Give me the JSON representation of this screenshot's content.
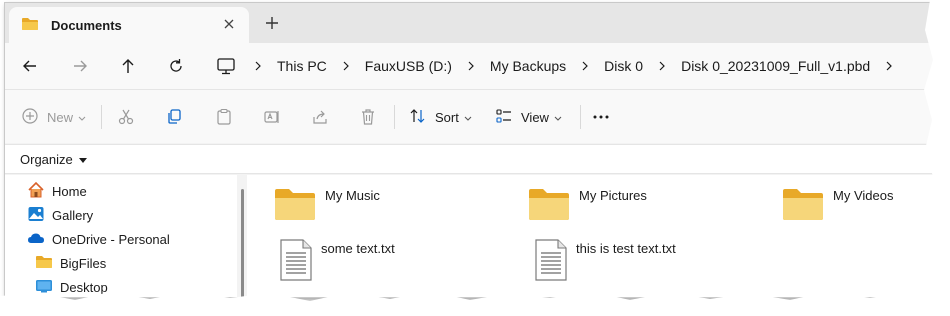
{
  "window": {
    "tab_title": "Documents",
    "new_tab_icon": "plus-icon",
    "close_icon": "close-icon"
  },
  "nav": {
    "back_icon": "arrow-left-icon",
    "forward_icon": "arrow-right-icon",
    "up_icon": "arrow-up-icon",
    "refresh_icon": "refresh-icon"
  },
  "breadcrumb": {
    "root_icon": "computer-icon",
    "items": [
      "This PC",
      "FauxUSB (D:)",
      "My Backups",
      "Disk 0",
      "Disk 0_20231009_Full_v1.pbd"
    ]
  },
  "commands": {
    "new_label": "New",
    "cut_icon": "cut-icon",
    "copy_icon": "copy-icon",
    "paste_icon": "paste-icon",
    "rename_icon": "rename-icon",
    "share_icon": "share-icon",
    "delete_icon": "delete-icon",
    "sort_label": "Sort",
    "view_label": "View",
    "more_icon": "more-icon"
  },
  "organize_label": "Organize",
  "sidebar": {
    "items": [
      {
        "label": "Home",
        "icon": "home-icon"
      },
      {
        "label": "Gallery",
        "icon": "gallery-icon"
      },
      {
        "label": "OneDrive - Personal",
        "icon": "cloud-icon"
      },
      {
        "label": "BigFiles",
        "icon": "folder-icon"
      },
      {
        "label": "Desktop",
        "icon": "desktop-icon"
      }
    ]
  },
  "files": [
    {
      "name": "My Music",
      "type": "folder"
    },
    {
      "name": "My Pictures",
      "type": "folder"
    },
    {
      "name": "My Videos",
      "type": "folder"
    },
    {
      "name": "some text.txt",
      "type": "text"
    },
    {
      "name": "this is test text.txt",
      "type": "text"
    }
  ],
  "colors": {
    "folder": "#f6c84a",
    "folder_dark": "#e8a928",
    "accent": "#0a64c8"
  }
}
